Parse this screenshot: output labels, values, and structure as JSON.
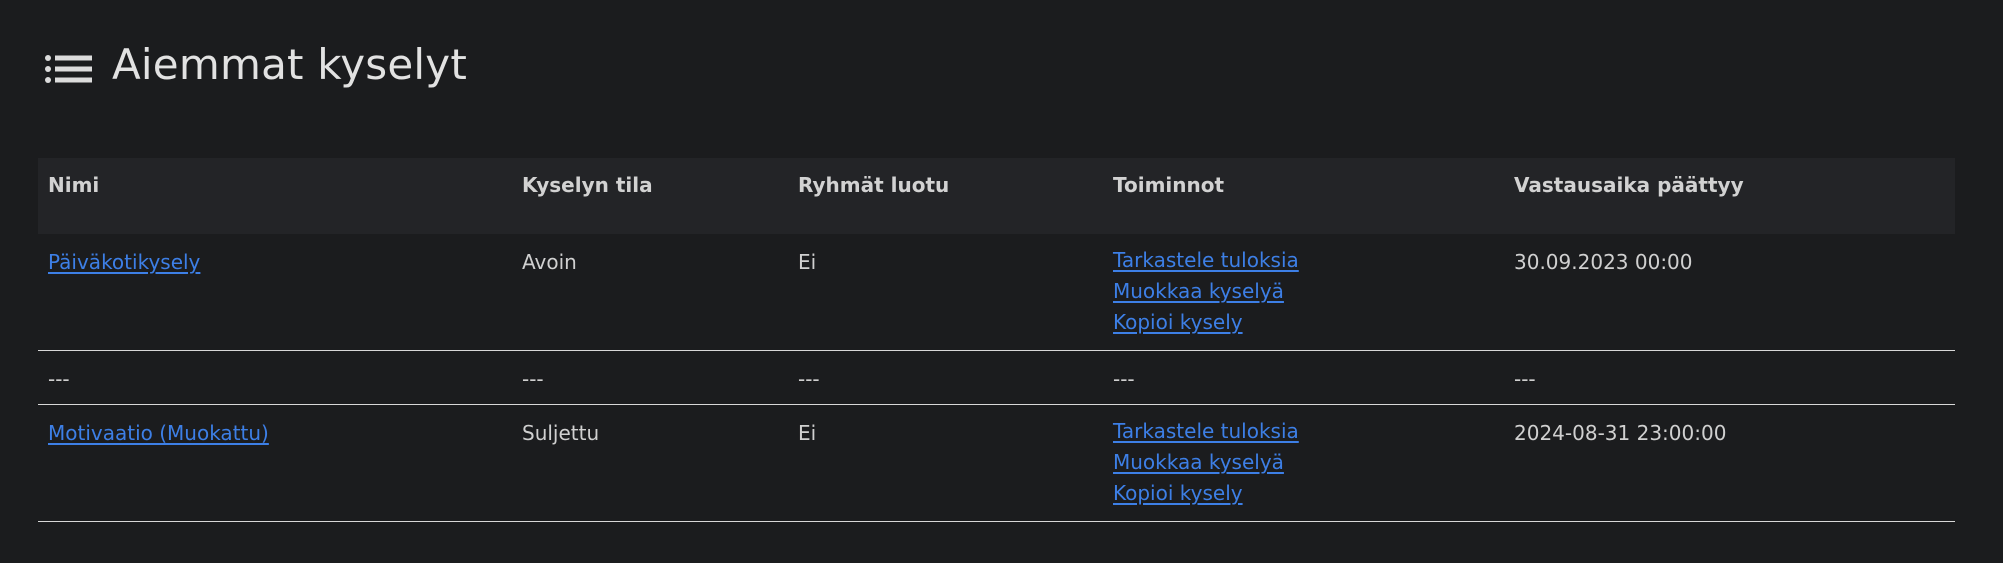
{
  "heading": {
    "title": "Aiemmat kyselyt",
    "icon": "list-icon"
  },
  "table": {
    "headers": {
      "name": "Nimi",
      "status": "Kyselyn tila",
      "groups": "Ryhmät luotu",
      "actions": "Toiminnot",
      "deadline": "Vastausaika päättyy"
    },
    "rows": [
      {
        "name": "Päiväkotikysely",
        "status": "Avoin",
        "groups": "Ei",
        "actions": [
          "Tarkastele tuloksia",
          "Muokkaa kyselyä",
          "Kopioi kysely"
        ],
        "deadline": "30.09.2023 00:00"
      },
      {
        "name": "---",
        "status": "---",
        "groups": "---",
        "actions": "---",
        "deadline": "---"
      },
      {
        "name": "Motivaatio (Muokattu)",
        "status": "Suljettu",
        "groups": "Ei",
        "actions": [
          "Tarkastele tuloksia",
          "Muokkaa kyselyä",
          "Kopioi kysely"
        ],
        "deadline": "2024-08-31 23:00:00"
      }
    ]
  },
  "colors": {
    "background": "#1b1c1e",
    "header_bg": "#232427",
    "link": "#3d7fe6",
    "text": "#d0d0d0"
  }
}
